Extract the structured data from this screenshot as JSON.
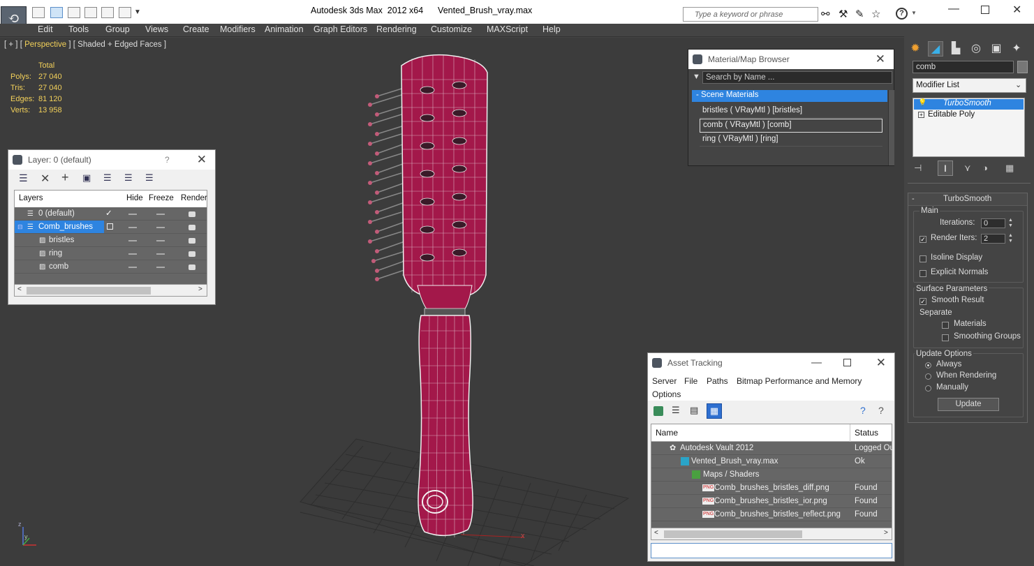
{
  "window": {
    "title": "Autodesk 3ds Max  2012 x64      Vented_Brush_vray.max",
    "search_placeholder": "Type a keyword or phrase"
  },
  "menu": [
    "Edit",
    "Tools",
    "Group",
    "Views",
    "Create",
    "Modifiers",
    "Animation",
    "Graph Editors",
    "Rendering",
    "Customize",
    "MAXScript",
    "Help"
  ],
  "viewport": {
    "label_pre": "[ + ] [ ",
    "label_view": "Perspective",
    "label_post": " ] [ Shaded + Edged Faces ]",
    "stats_header": "Total",
    "stats": [
      {
        "k": "Polys:",
        "v": "27 040"
      },
      {
        "k": "Tris:",
        "v": "27 040"
      },
      {
        "k": "Edges:",
        "v": "81 120"
      },
      {
        "k": "Verts:",
        "v": "13 958"
      }
    ],
    "axis_z": "z",
    "axis_y": "y",
    "axis_x": "x"
  },
  "layer_panel": {
    "title": "Layer: 0 (default)",
    "help": "?",
    "columns": [
      "Layers",
      "Hide",
      "Freeze",
      "Render"
    ],
    "rows": [
      {
        "name": "0 (default)"
      },
      {
        "name": "Comb_brushes"
      },
      {
        "name": "bristles"
      },
      {
        "name": "ring"
      },
      {
        "name": "comb"
      }
    ]
  },
  "material_browser": {
    "title": "Material/Map Browser",
    "search_placeholder": "Search by Name ...",
    "section": "- Scene Materials",
    "items": [
      "bristles  ( VRayMtl ) [bristles]",
      "comb  ( VRayMtl ) [comb]",
      "ring  ( VRayMtl ) [ring]"
    ]
  },
  "asset_tracking": {
    "title": "Asset Tracking",
    "menu": [
      "Server",
      "File",
      "Paths",
      "Bitmap Performance and Memory",
      "Options"
    ],
    "columns": [
      "Name",
      "Status"
    ],
    "rows": [
      {
        "name": "Autodesk Vault 2012",
        "status": "Logged Ou"
      },
      {
        "name": "Vented_Brush_vray.max",
        "status": "Ok"
      },
      {
        "name": "Maps / Shaders",
        "status": ""
      },
      {
        "name": "Comb_brushes_bristles_diff.png",
        "status": "Found"
      },
      {
        "name": "Comb_brushes_bristles_ior.png",
        "status": "Found"
      },
      {
        "name": "Comb_brushes_bristles_reflect.png",
        "status": "Found"
      }
    ],
    "png_tag": "PNG"
  },
  "command_panel": {
    "object_name": "comb",
    "modifier_list": "Modifier List",
    "stack": [
      "TurboSmooth",
      "Editable Poly"
    ],
    "rollout_title": "TurboSmooth",
    "main_label": "Main",
    "iterations_label": "Iterations:",
    "iterations_value": "0",
    "render_iters_label": "Render Iters:",
    "render_iters_value": "2",
    "isoline_display": "Isoline Display",
    "explicit_normals": "Explicit Normals",
    "surface_parameters": "Surface Parameters",
    "smooth_result": "Smooth Result",
    "separate": "Separate",
    "materials": "Materials",
    "smoothing_groups": "Smoothing Groups",
    "update_options": "Update Options",
    "always": "Always",
    "when_rendering": "When Rendering",
    "manually": "Manually",
    "update_button": "Update",
    "collapse": "-"
  },
  "colors": {
    "accent_blue": "#2e84e0",
    "brush_red": "#a3184a",
    "stats_yellow": "#f3d15a"
  }
}
